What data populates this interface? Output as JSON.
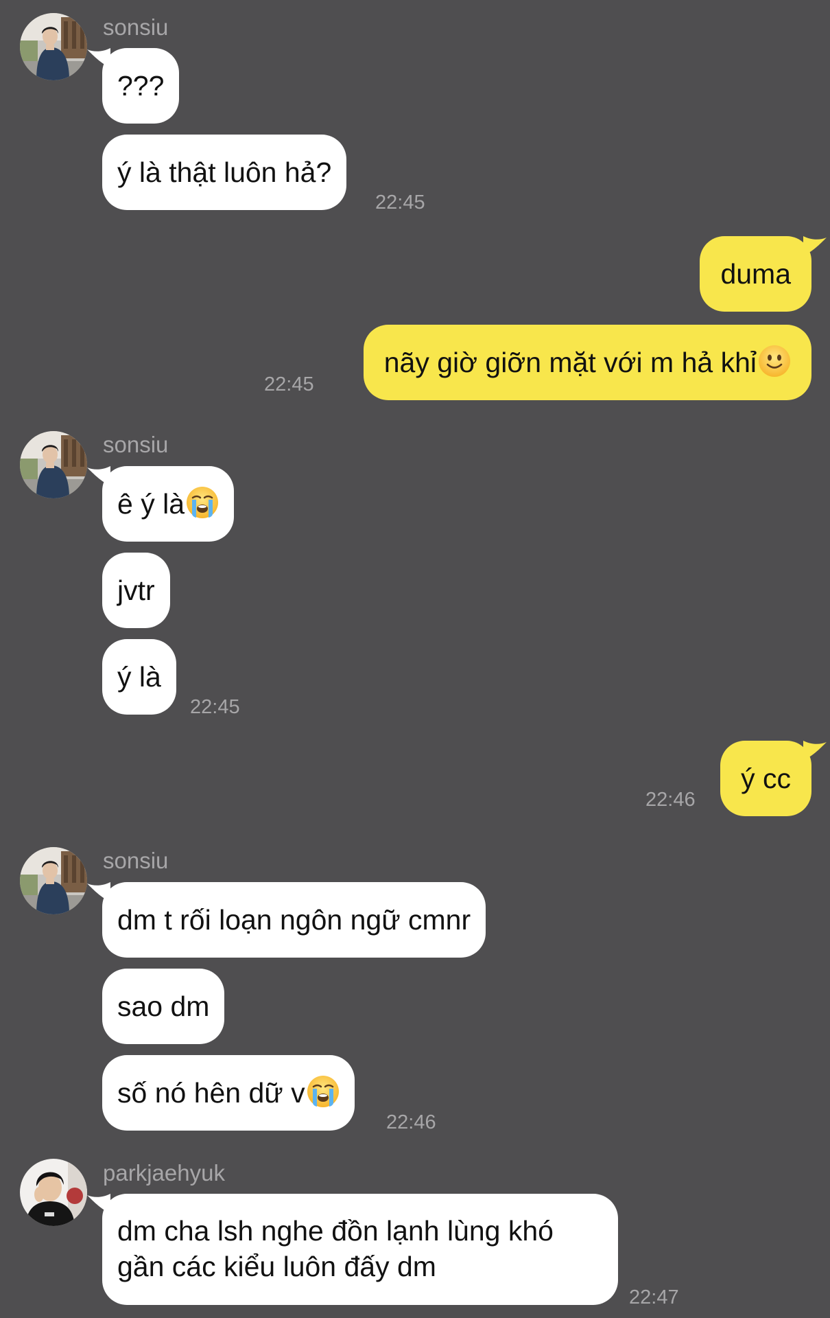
{
  "conversation": {
    "group1": {
      "sender": "sonsiu",
      "messages": [
        "???",
        "ý là thật luôn hả?"
      ],
      "time": "22:45"
    },
    "mine1": {
      "messages": [
        "duma",
        "nãy giờ giỡn mặt với m hả khỉ"
      ],
      "emoji": "slightly-smiling-face-emoji",
      "time": "22:45"
    },
    "group2": {
      "sender": "sonsiu",
      "messages": [
        "ê ý là",
        "jvtr",
        "ý là"
      ],
      "emoji": "loudly-crying-face-emoji",
      "time": "22:45"
    },
    "mine2": {
      "messages": [
        "ý cc"
      ],
      "time": "22:46"
    },
    "group3": {
      "sender": "sonsiu",
      "messages": [
        "dm t rối loạn ngôn ngữ cmnr",
        "sao dm",
        "số nó hên dữ v"
      ],
      "emoji": "loudly-crying-face-emoji",
      "time": "22:46"
    },
    "group4": {
      "sender": "parkjaehyuk",
      "messages": [
        "dm cha lsh nghe đồn lạnh lùng khó gần các kiểu luôn đấy dm"
      ],
      "time": "22:47"
    }
  },
  "colors": {
    "background": "#4f4e50",
    "incoming_bubble": "#ffffff",
    "outgoing_bubble": "#f8e64c",
    "meta_text": "#a7a6a8"
  }
}
